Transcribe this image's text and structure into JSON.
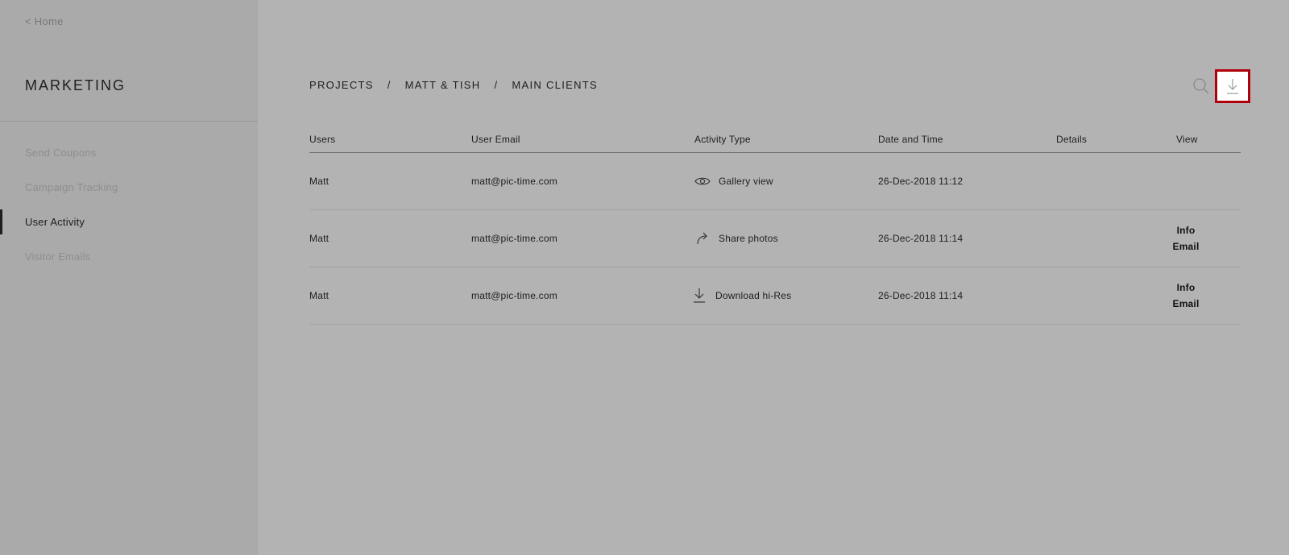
{
  "sidebar": {
    "home_label": "< Home",
    "title": "MARKETING",
    "items": [
      {
        "label": "Send Coupons",
        "active": false
      },
      {
        "label": "Campaign Tracking",
        "active": false
      },
      {
        "label": "User Activity",
        "active": true
      },
      {
        "label": "Visitor Emails",
        "active": false
      }
    ]
  },
  "breadcrumb": {
    "items": [
      "PROJECTS",
      "MATT & TISH",
      "MAIN CLIENTS"
    ],
    "separator": "/"
  },
  "toolbar": {
    "search_icon": "search-icon",
    "download_icon": "download-icon",
    "download_highlight_color": "#b0000a"
  },
  "table": {
    "columns": [
      "Users",
      "User Email",
      "Activity Type",
      "Date and Time",
      "Details",
      "View"
    ],
    "rows": [
      {
        "user": "Matt",
        "email": "matt@pic-time.com",
        "activity_icon": "eye-icon",
        "activity": "Gallery view",
        "datetime": "26-Dec-2018 11:12",
        "details": "",
        "view": []
      },
      {
        "user": "Matt",
        "email": "matt@pic-time.com",
        "activity_icon": "share-arrow-icon",
        "activity": "Share photos",
        "datetime": "26-Dec-2018 11:14",
        "details": "",
        "view": [
          "Info",
          "Email"
        ]
      },
      {
        "user": "Matt",
        "email": "matt@pic-time.com",
        "activity_icon": "download-icon",
        "activity": "Download hi-Res",
        "datetime": "26-Dec-2018 11:14",
        "details": "",
        "view": [
          "Info",
          "Email"
        ]
      }
    ]
  }
}
